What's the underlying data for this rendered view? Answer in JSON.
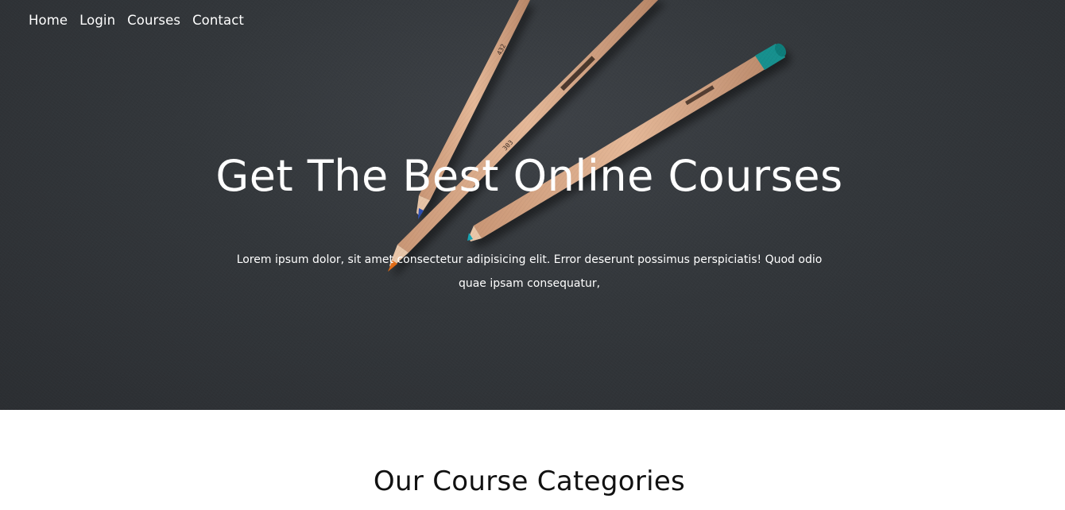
{
  "nav": {
    "items": [
      {
        "label": "Home"
      },
      {
        "label": "Login"
      },
      {
        "label": "Courses"
      },
      {
        "label": "Contact"
      }
    ]
  },
  "hero": {
    "title": "Get The Best Online Courses",
    "text": "Lorem ipsum dolor, sit amet consectetur adipisicing elit. Error deserunt possimus perspiciatis! Quod odio quae ipsam consequatur,",
    "pencil_labels": {
      "left": "432",
      "middle": "303"
    }
  },
  "categories": {
    "title": "Our Course Categories"
  }
}
